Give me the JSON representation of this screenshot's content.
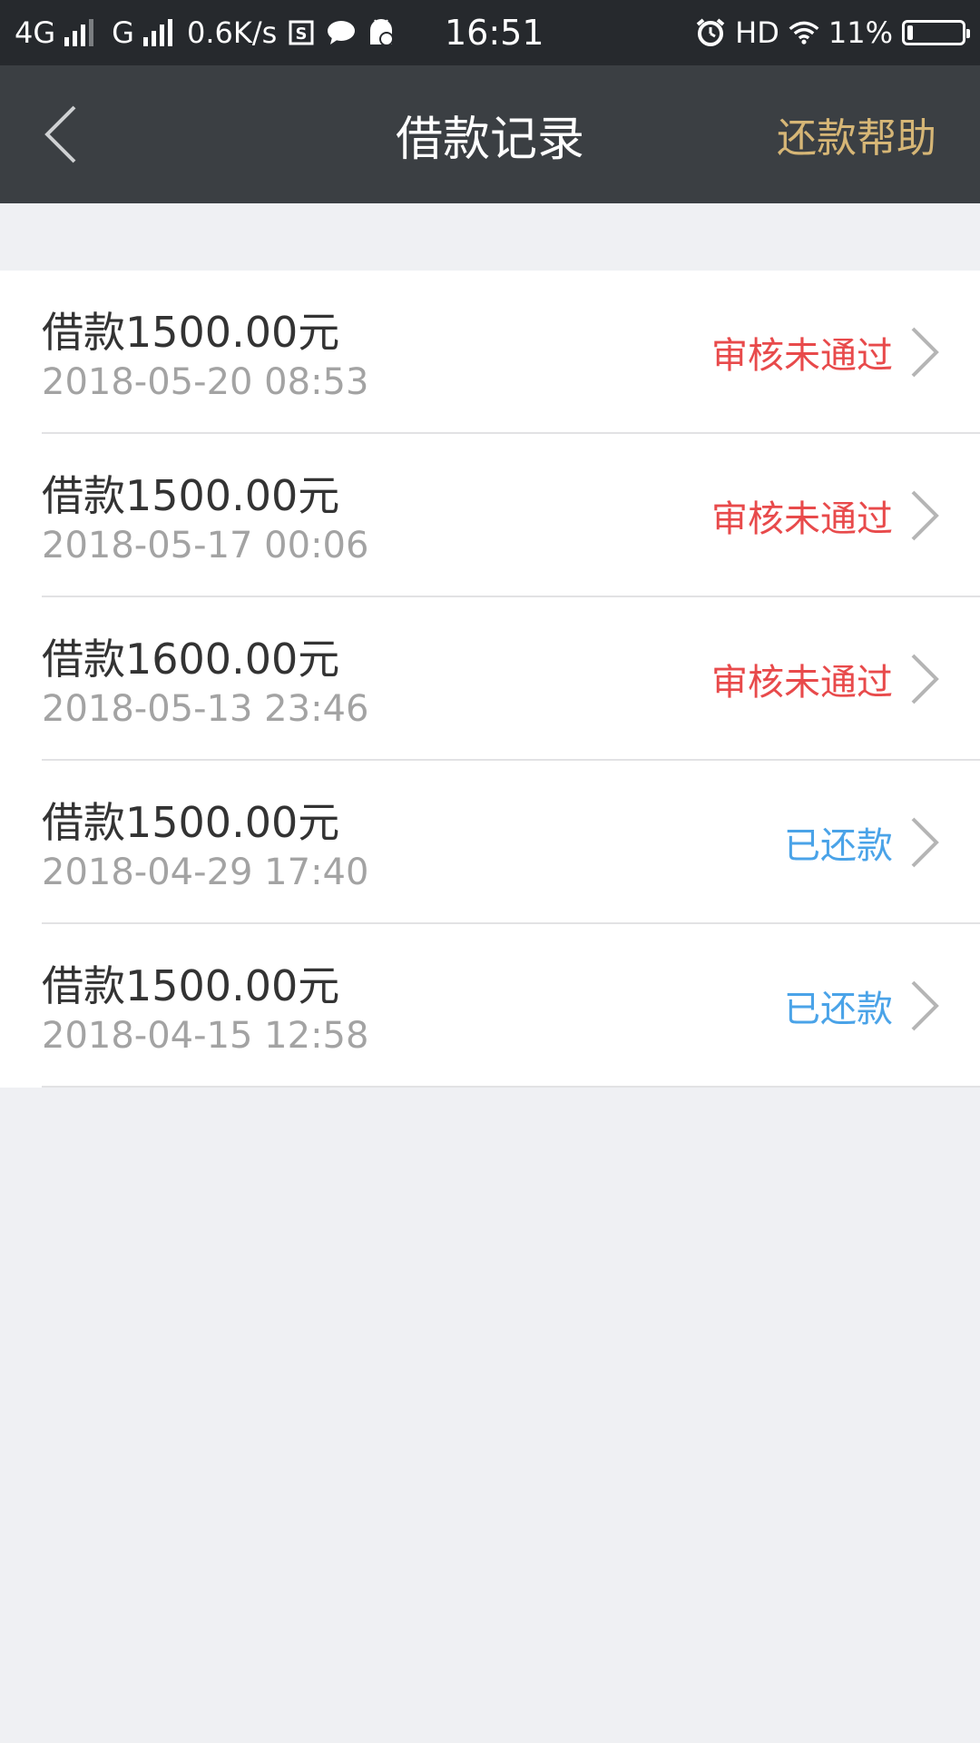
{
  "status_bar": {
    "network_1": "4G",
    "network_2": "G",
    "speed": "0.6K/s",
    "time": "16:51",
    "hd": "HD",
    "battery_text": "11%",
    "battery_level": 0.11
  },
  "nav": {
    "title": "借款记录",
    "action": "还款帮助"
  },
  "records": [
    {
      "amount": "借款1500.00元",
      "time": "2018-05-20 08:53",
      "status": "审核未通过",
      "status_type": "rejected"
    },
    {
      "amount": "借款1500.00元",
      "time": "2018-05-17 00:06",
      "status": "审核未通过",
      "status_type": "rejected"
    },
    {
      "amount": "借款1600.00元",
      "time": "2018-05-13 23:46",
      "status": "审核未通过",
      "status_type": "rejected"
    },
    {
      "amount": "借款1500.00元",
      "time": "2018-04-29 17:40",
      "status": "已还款",
      "status_type": "repaid"
    },
    {
      "amount": "借款1500.00元",
      "time": "2018-04-15 12:58",
      "status": "已还款",
      "status_type": "repaid"
    }
  ],
  "colors": {
    "status_bar_bg": "#26292d",
    "nav_bg": "#3b3f43",
    "nav_action": "#d6b676",
    "rejected": "#e84a4b",
    "repaid": "#4aa3e8",
    "page_bg": "#eff0f3"
  },
  "icons": {
    "back": "chevron-left-icon",
    "row_arrow": "chevron-right-icon"
  }
}
